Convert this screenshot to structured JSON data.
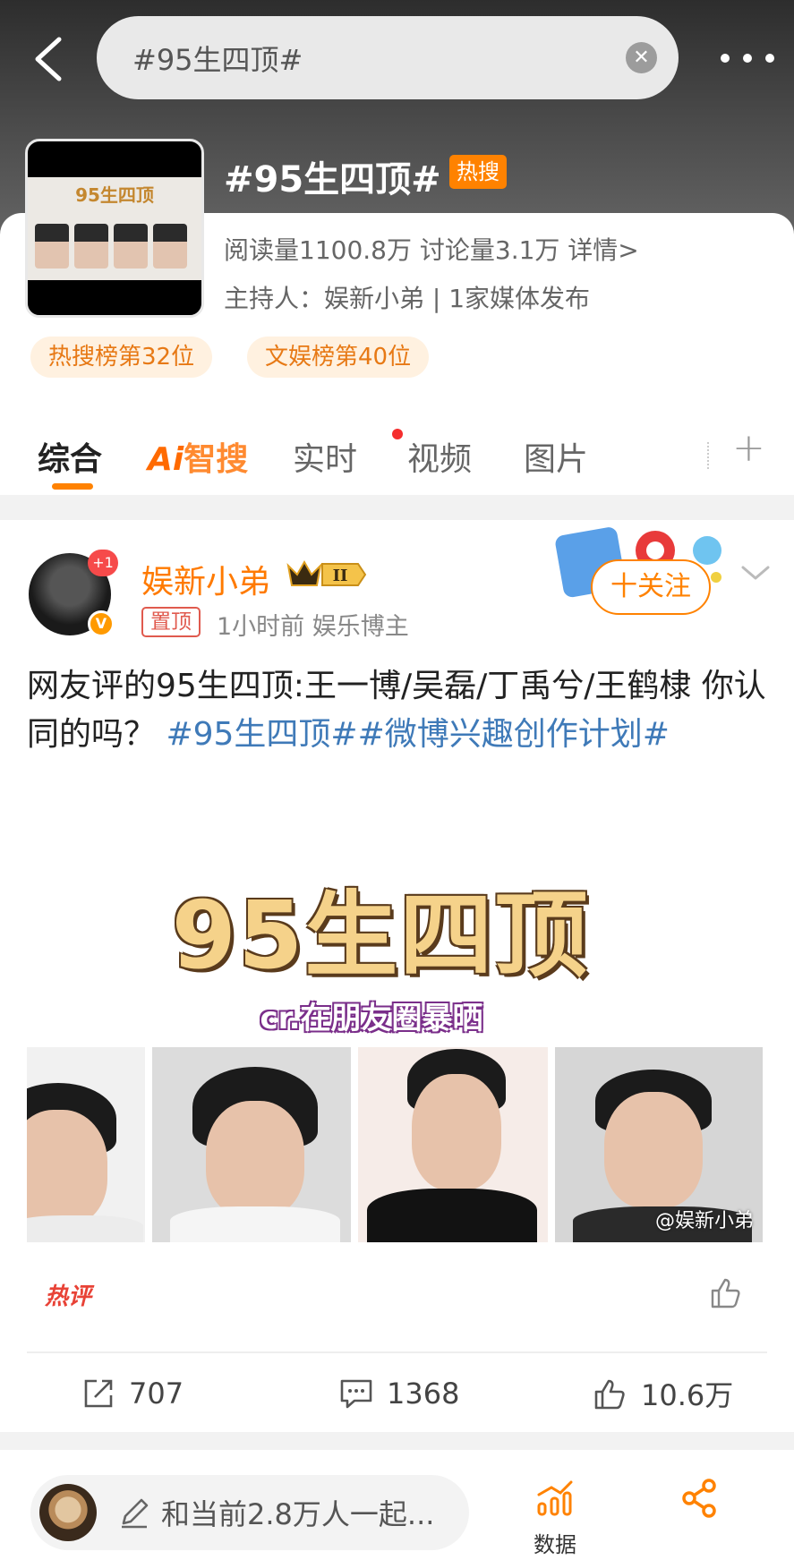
{
  "search": {
    "query": "#95生四顶#"
  },
  "topic": {
    "title": "#95生四顶#",
    "hot_badge": "热搜",
    "thumb_title": "95生四顶",
    "stats": "阅读量1100.8万  讨论量3.1万  详情>",
    "host": "主持人：娱新小弟 | 1家媒体发布",
    "ranks": [
      "热搜榜第32位",
      "文娱榜第40位"
    ]
  },
  "tabs": [
    {
      "label": "综合",
      "active": true
    },
    {
      "label_ai": "Ai",
      "label_rest": "智搜"
    },
    {
      "label": "实时",
      "dot": true
    },
    {
      "label": "视频"
    },
    {
      "label": "图片"
    }
  ],
  "post": {
    "author": "娱新小弟",
    "badge_plus": "+1",
    "crown_level": "II",
    "pin": "置顶",
    "meta": "1小时前   娱乐博主",
    "follow": "十关注",
    "text_plain": "网友评的95生四顶:王一博/吴磊/丁禹兮/王鹤棣   你认同的吗？   ",
    "text_tag": "#95生四顶##微博兴趣创作计划#",
    "image": {
      "title": "95生四顶",
      "subtitle": "cr.在朋友圈暴晒",
      "watermark": "@娱新小弟"
    },
    "hot_comment": "热评",
    "reposts": "707",
    "comments": "1368",
    "likes": "10.6万"
  },
  "bottom": {
    "compose_placeholder": "和当前2.8万人一起...",
    "data_label": "数据"
  },
  "colors": {
    "accent": "#ff8200",
    "tag": "#3f7ab8",
    "hot": "#e84236"
  }
}
